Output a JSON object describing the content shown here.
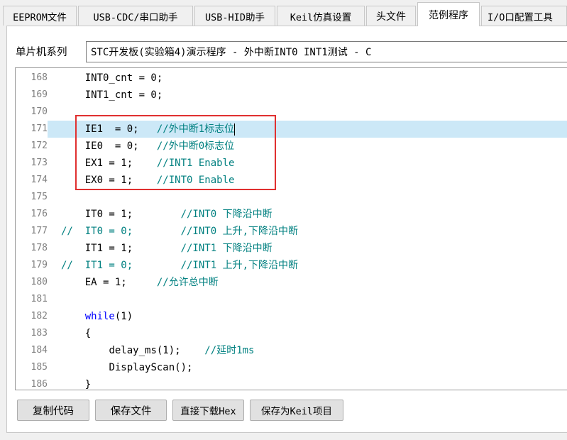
{
  "tabs": [
    {
      "label": "EEPROM文件"
    },
    {
      "label": "USB-CDC/串口助手"
    },
    {
      "label": "USB-HID助手"
    },
    {
      "label": "Keil仿真设置"
    },
    {
      "label": "头文件"
    },
    {
      "label": "范例程序",
      "active": true
    },
    {
      "label": "I/O口配置工具"
    }
  ],
  "series": {
    "label": "单片机系列",
    "selected": "STC开发板(实验箱4)演示程序 - 外中断INT0 INT1测试 - C"
  },
  "editor": {
    "highlighted_line": 171,
    "callout_color": "#e03030",
    "lines": [
      {
        "num": "168",
        "code": "INT0_cnt = 0;",
        "indent": "    "
      },
      {
        "num": "169",
        "code": "INT1_cnt = 0;",
        "indent": "    "
      },
      {
        "num": "170",
        "code": "",
        "indent": ""
      },
      {
        "num": "171",
        "code": "IE1  = 0;   ",
        "comment": "//外中断1标志位",
        "indent": "    "
      },
      {
        "num": "172",
        "code": "IE0  = 0;   ",
        "comment": "//外中断0标志位",
        "indent": "    "
      },
      {
        "num": "173",
        "code": "EX1 = 1;    ",
        "comment": "//INT1 Enable",
        "indent": "    "
      },
      {
        "num": "174",
        "code": "EX0 = 1;    ",
        "comment": "//INT0 Enable",
        "indent": "    "
      },
      {
        "num": "175",
        "code": "",
        "indent": ""
      },
      {
        "num": "176",
        "code": "IT0 = 1;        ",
        "comment": "//INT0 下降沿中断",
        "indent": "    "
      },
      {
        "num": "177",
        "prefix": "//  ",
        "code": "IT0 = 0;        ",
        "comment": "//INT0 上升,下降沿中断",
        "indent": "",
        "commented": true
      },
      {
        "num": "178",
        "code": "IT1 = 1;        ",
        "comment": "//INT1 下降沿中断",
        "indent": "    "
      },
      {
        "num": "179",
        "prefix": "//  ",
        "code": "IT1 = 0;        ",
        "comment": "//INT1 上升,下降沿中断",
        "indent": "",
        "commented": true
      },
      {
        "num": "180",
        "code": "EA = 1;     ",
        "comment": "//允许总中断",
        "indent": "    "
      },
      {
        "num": "181",
        "code": "",
        "indent": ""
      },
      {
        "num": "182",
        "kw": "while",
        "code": "(1)",
        "indent": "    "
      },
      {
        "num": "183",
        "code": "{",
        "indent": "    "
      },
      {
        "num": "184",
        "code": "delay_ms(1);    ",
        "comment": "//延时1ms",
        "indent": "        "
      },
      {
        "num": "185",
        "code": "DisplayScan();",
        "indent": "        "
      },
      {
        "num": "186",
        "code": "}",
        "indent": "    "
      }
    ]
  },
  "buttons": {
    "copy": "复制代码",
    "save_file": "保存文件",
    "download_hex": "直接下载Hex",
    "save_keil": "保存为Keil项目"
  }
}
